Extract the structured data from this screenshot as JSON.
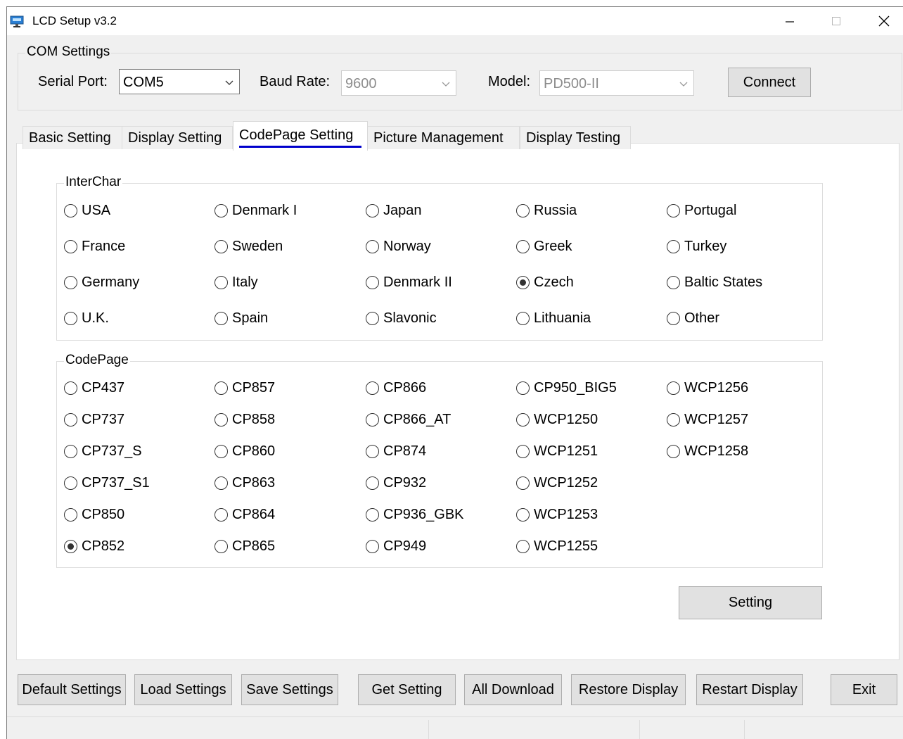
{
  "window": {
    "title": "LCD Setup v3.2"
  },
  "com": {
    "group_label": "COM Settings",
    "serial_label": "Serial Port:",
    "serial_value": "COM5",
    "baud_label": "Baud Rate:",
    "baud_value": "9600",
    "model_label": "Model:",
    "model_value": "PD500-II",
    "connect_label": "Connect"
  },
  "tabs": [
    {
      "label": "Basic Setting"
    },
    {
      "label": "Display Setting"
    },
    {
      "label": "CodePage Setting"
    },
    {
      "label": "Picture Management"
    },
    {
      "label": "Display Testing"
    }
  ],
  "active_tab": "CodePage Setting",
  "interchar": {
    "label": "InterChar",
    "selected": "Czech",
    "options": [
      "USA",
      "Denmark I",
      "Japan",
      "Russia",
      "Portugal",
      "France",
      "Sweden",
      "Norway",
      "Greek",
      "Turkey",
      "Germany",
      "Italy",
      "Denmark II",
      "Czech",
      "Baltic States",
      "U.K.",
      "Spain",
      "Slavonic",
      "Lithuania",
      "Other"
    ]
  },
  "codepage": {
    "label": "CodePage",
    "selected": "CP852",
    "columns": [
      [
        "CP437",
        "CP737",
        "CP737_S",
        "CP737_S1",
        "CP850",
        "CP852"
      ],
      [
        "CP857",
        "CP858",
        "CP860",
        "CP863",
        "CP864",
        "CP865"
      ],
      [
        "CP866",
        "CP866_AT",
        "CP874",
        "CP932",
        "CP936_GBK",
        "CP949"
      ],
      [
        "CP950_BIG5",
        "WCP1250",
        "WCP1251",
        "WCP1252",
        "WCP1253",
        "WCP1255"
      ],
      [
        "WCP1256",
        "WCP1257",
        "WCP1258"
      ]
    ]
  },
  "setting_label": "Setting",
  "bottom_buttons": [
    {
      "label": "Default Settings"
    },
    {
      "label": "Load Settings"
    },
    {
      "label": "Save Settings"
    },
    {
      "label": "Get Setting"
    },
    {
      "label": "All Download"
    },
    {
      "label": "Restore Display"
    },
    {
      "label": "Restart Display"
    },
    {
      "label": "Exit"
    }
  ]
}
